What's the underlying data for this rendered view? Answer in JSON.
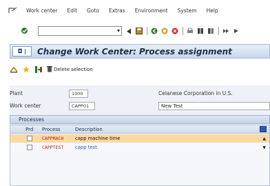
{
  "menubar": {
    "items": [
      "Work center",
      "Edit",
      "Goto",
      "Extras",
      "Environment",
      "System",
      "Help"
    ]
  },
  "toolbar": {
    "command_value": ""
  },
  "title": "Change Work Center: Process assignment",
  "app_toolbar": {
    "delete_selection_label": "Delete selection"
  },
  "fields": {
    "plant_label": "Plant",
    "plant_value": "1000",
    "company_label": "Celanese Corporation in U.S.",
    "work_center_label": "Work center",
    "work_center_value": "CAPP01",
    "work_center_desc": "New Test"
  },
  "processes": {
    "section_title": "Processes",
    "columns": [
      "Prd",
      "Process",
      "Description"
    ],
    "rows": [
      {
        "process": "CAPPMACH",
        "description": "capp machine time"
      },
      {
        "process": "CAPPTEST",
        "description": "capp test"
      }
    ]
  },
  "colors": {
    "selected_row": "#fbd9a4",
    "process_text": "#b71c1c",
    "link_text": "#1f5fbf",
    "title_bar": "#c9d6ea"
  }
}
